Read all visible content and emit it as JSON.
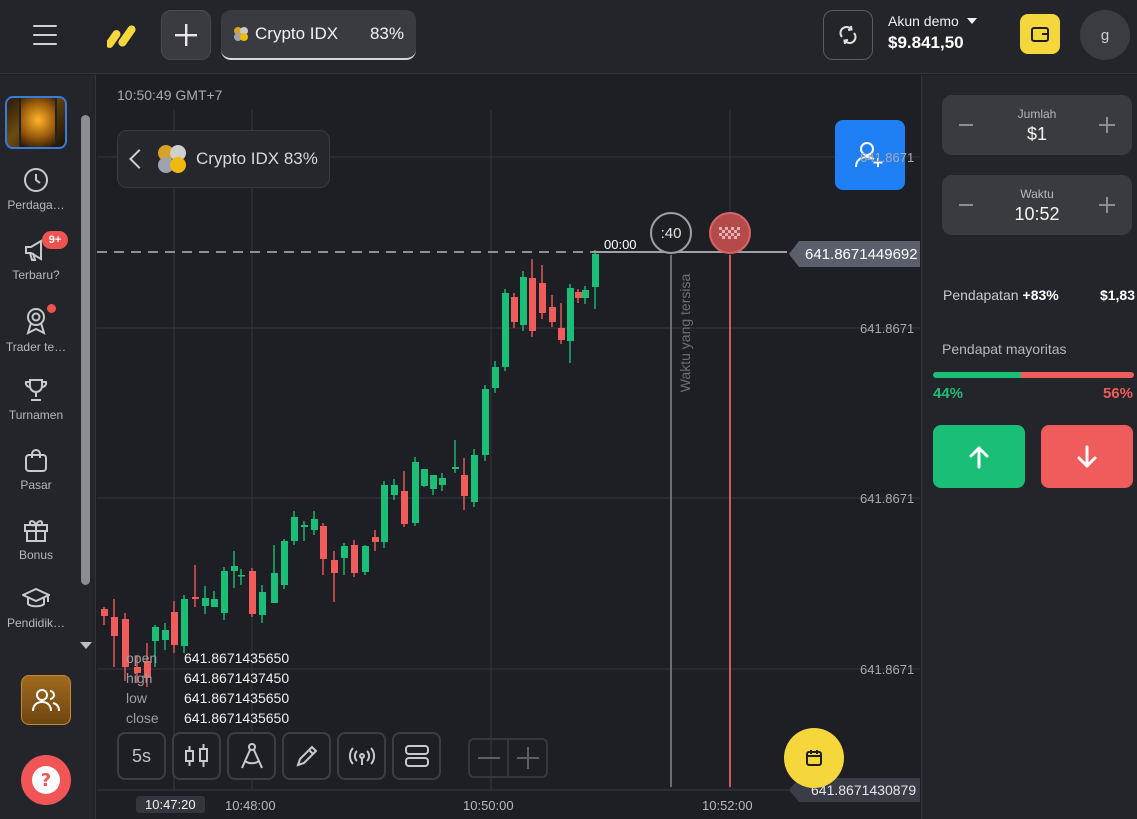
{
  "topbar": {
    "asset_name": "Crypto IDX",
    "asset_pct": "83%",
    "account_label": "Akun demo",
    "balance": "$9.841,50",
    "avatar_initial": "g"
  },
  "sidebar": {
    "items": [
      {
        "label": "Perdaga…",
        "icon": "clock-icon"
      },
      {
        "label": "Terbaru?",
        "icon": "megaphone-icon",
        "badge": "9+"
      },
      {
        "label": "Trader te…",
        "icon": "award-icon"
      },
      {
        "label": "Turnamen",
        "icon": "trophy-icon"
      },
      {
        "label": "Pasar",
        "icon": "bag-icon"
      },
      {
        "label": "Bonus",
        "icon": "gift-icon"
      },
      {
        "label": "Pendidik…",
        "icon": "graduation-cap-icon"
      }
    ]
  },
  "chart": {
    "server_time": "10:50:49 GMT+7",
    "asset_label": "Crypto IDX 83%",
    "current_price": "641.8671449692",
    "bottom_price": "641.8671430879",
    "timer": ":40",
    "zero_label": "00:00",
    "remaining_label": "Waktu yang tersisa",
    "y_labels": [
      "641.8671",
      "641.8671",
      "641.8671",
      "641.8671"
    ],
    "x_labels": [
      "10:47:20",
      "10:48:00",
      "10:50:00",
      "10:52:00"
    ],
    "ohlc": [
      {
        "k": "open",
        "v": "641.8671435650"
      },
      {
        "k": "high",
        "v": "641.8671437450"
      },
      {
        "k": "low",
        "v": "641.8671435650"
      },
      {
        "k": "close",
        "v": "641.8671435650"
      }
    ],
    "timeframe": "5s",
    "colors": {
      "up": "#1bbe77",
      "down": "#f05b5b"
    }
  },
  "panel": {
    "amount_label": "Jumlah",
    "amount_value": "$1",
    "time_label": "Waktu",
    "time_value": "10:52",
    "income_label": "Pendapatan",
    "income_pct": "+83%",
    "income_amount": "$1,83",
    "majority_label": "Pendapat mayoritas",
    "up_share": 0.44,
    "up_pct": "44%",
    "down_pct": "56%"
  }
}
